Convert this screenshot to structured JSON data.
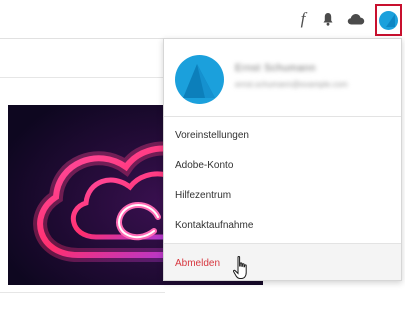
{
  "toolbar": {
    "fonts_glyph": "f",
    "icons": [
      "fonts-icon",
      "bell-icon",
      "cloud-icon",
      "avatar"
    ]
  },
  "colors": {
    "accent": "#1ba0dc",
    "highlight_border": "#c8102e",
    "signout": "#d7373f"
  },
  "profile": {
    "name": "Ernst Schumann",
    "email": "ernst.schumann@example.com"
  },
  "menu": {
    "items": [
      {
        "label": "Voreinstellungen"
      },
      {
        "label": "Adobe-Konto"
      },
      {
        "label": "Hilfezentrum"
      },
      {
        "label": "Kontaktaufnahme"
      }
    ],
    "signout": "Abmelden"
  }
}
